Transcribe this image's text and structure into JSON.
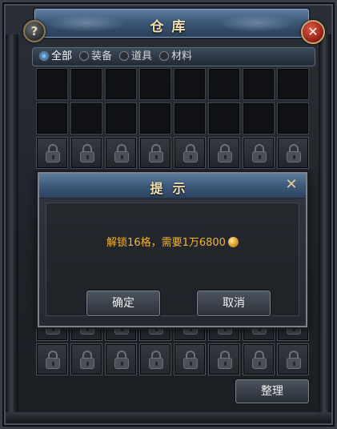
{
  "window": {
    "title": "仓库"
  },
  "buttons": {
    "help": "?",
    "close": "✕"
  },
  "tabs": [
    {
      "label": "全部",
      "active": true
    },
    {
      "label": "装备",
      "active": false
    },
    {
      "label": "道具",
      "active": false
    },
    {
      "label": "材料",
      "active": false
    }
  ],
  "grid": {
    "columns": 8,
    "rows": [
      [
        "empty",
        "empty",
        "empty",
        "empty",
        "empty",
        "empty",
        "empty",
        "empty"
      ],
      [
        "empty",
        "empty",
        "empty",
        "empty",
        "empty",
        "empty",
        "empty",
        "empty"
      ],
      [
        "locked",
        "locked",
        "locked",
        "locked",
        "locked",
        "locked",
        "locked",
        "locked"
      ],
      [
        "locked",
        "locked",
        "locked",
        "locked",
        "locked",
        "locked",
        "locked",
        "locked"
      ],
      [
        "locked",
        "locked",
        "locked",
        "locked",
        "locked",
        "locked",
        "locked",
        "locked"
      ],
      [
        "locked",
        "locked",
        "locked",
        "locked",
        "locked",
        "locked",
        "locked",
        "locked"
      ],
      [
        "locked",
        "locked",
        "locked",
        "locked",
        "locked",
        "locked",
        "locked",
        "locked"
      ],
      [
        "locked",
        "locked",
        "locked",
        "locked",
        "locked",
        "locked",
        "locked",
        "locked"
      ],
      [
        "locked",
        "locked",
        "locked",
        "locked",
        "locked",
        "locked",
        "locked",
        "locked"
      ]
    ],
    "lock_icon": "lock-icon"
  },
  "sort_button": "整理",
  "dialog": {
    "title": "提示",
    "close": "✕",
    "message": "解锁16格，需要1万6800",
    "currency_icon": "gold-coin-icon",
    "confirm": "确定",
    "cancel": "取消"
  },
  "colors": {
    "title_text": "#f4dfae",
    "message_text": "#f5b335",
    "titlebar_blue": "#3c5877"
  }
}
